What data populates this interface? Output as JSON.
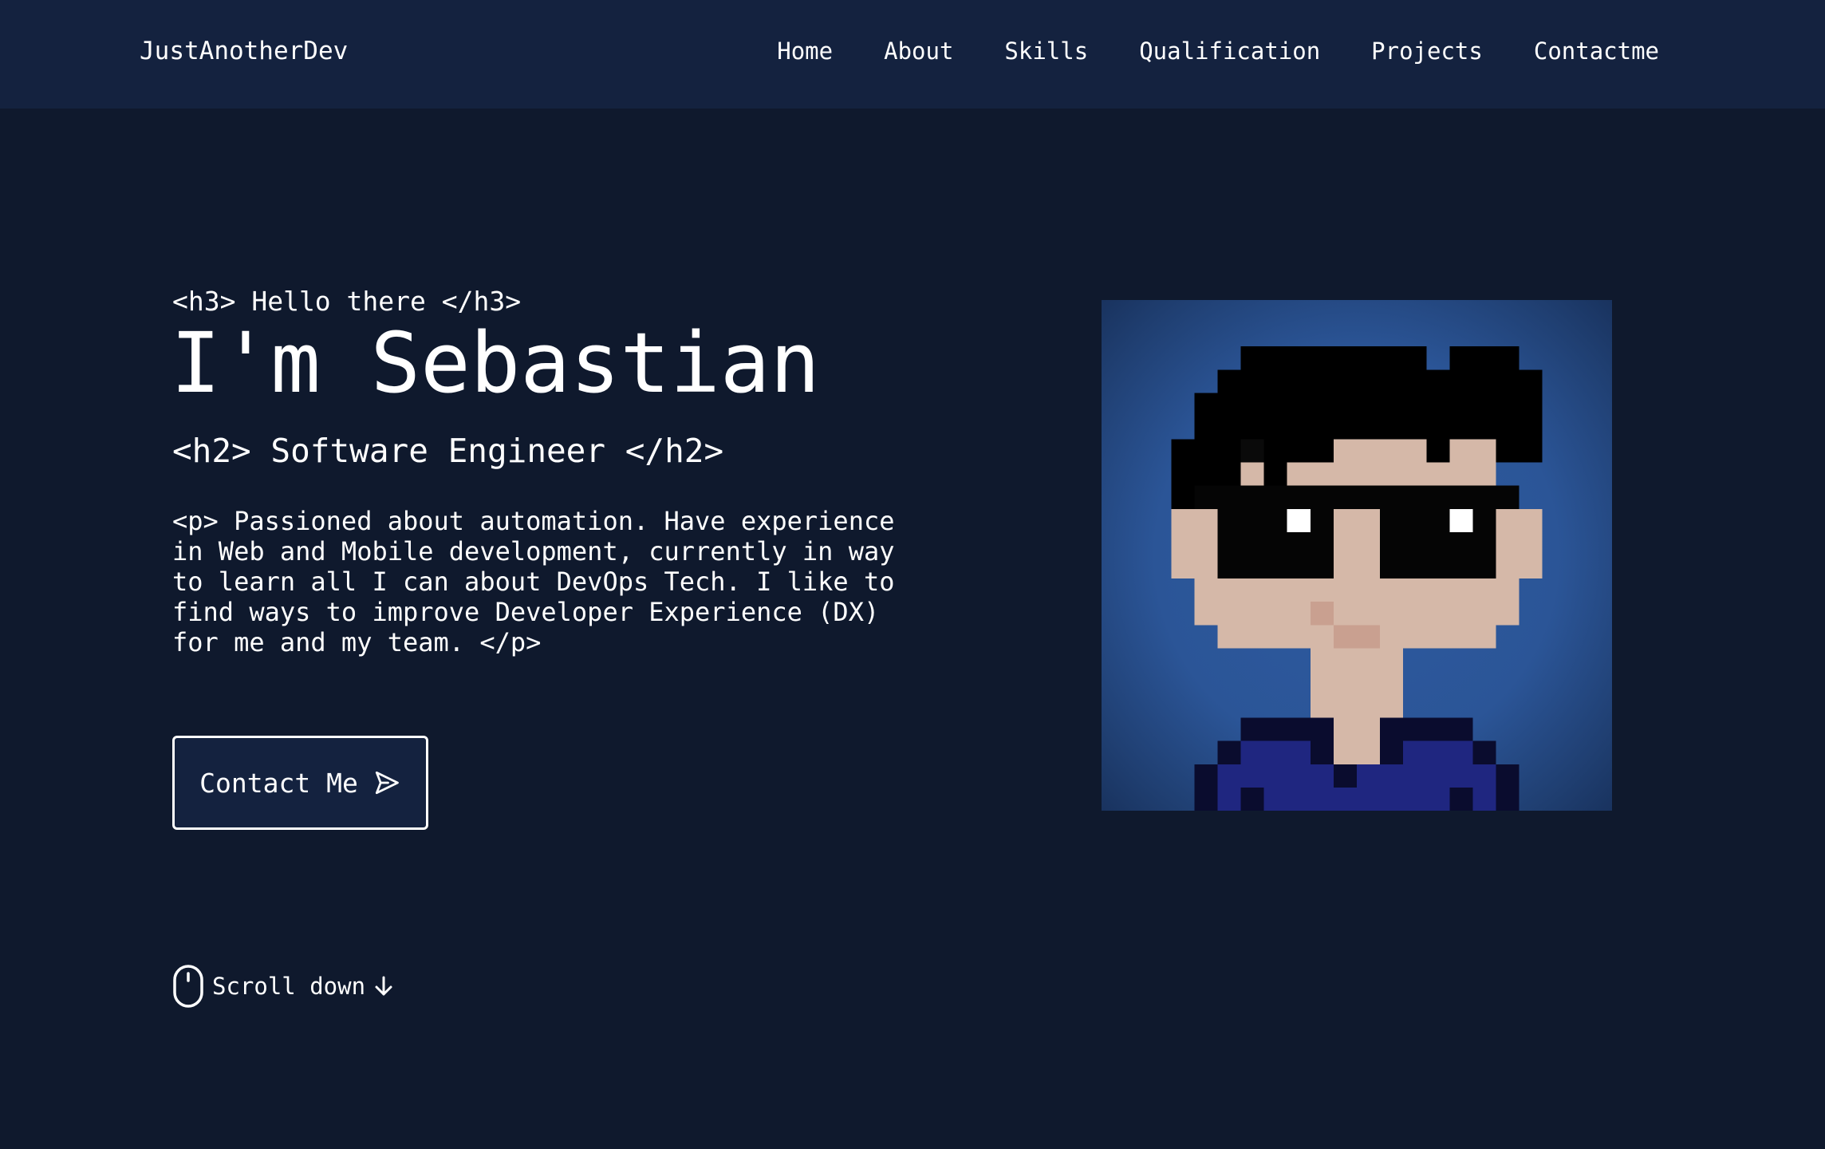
{
  "header": {
    "brand": "JustAnotherDev",
    "nav": [
      "Home",
      "About",
      "Skills",
      "Qualification",
      "Projects",
      "Contactme"
    ]
  },
  "hero": {
    "greeting": "<h3> Hello there </h3>",
    "title": "I'm Sebastian",
    "role": "<h2> Software Engineer </h2>",
    "description": "<p> Passioned about automation. Have experience\nin Web and Mobile development, currently in way\nto learn all I can about DevOps Tech. I like to\nfind ways to improve Developer Experience (DX)\nfor me and my team. </p>",
    "contact_button": "Contact Me",
    "scroll_label": "Scroll down"
  },
  "icons": {
    "contact_button": "send-icon",
    "scroll": "mouse-icon",
    "scroll_arrow": "arrow-down-icon"
  },
  "colors": {
    "background": "#0f192d",
    "header": "#14223f",
    "text": "#ffffff",
    "avatar_bg": "#2b5597",
    "skin": "#d5b8a8",
    "hair": "#000000",
    "shirt": "#1f2680"
  }
}
